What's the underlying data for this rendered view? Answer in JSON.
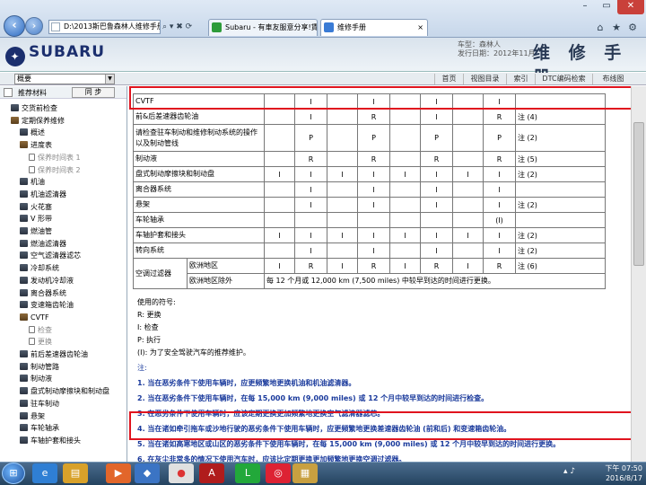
{
  "browser": {
    "address": "D:\\2013斯巴鲁森林人维修手册\\index.h",
    "tabs": [
      {
        "label": "Subaru - 有車友服意分享!賃5..."
      },
      {
        "label": "维修手册"
      }
    ],
    "back_icon": "back-arrow-icon",
    "forward_icon": "forward-arrow-icon"
  },
  "header": {
    "brand": "SUBARU",
    "model_line": "车型：森林人",
    "date_line": "发行日期：2012年11月",
    "title": "维 修 手 册"
  },
  "navbar": {
    "outline_value": "概要",
    "links": [
      "首页",
      "视图目录",
      "索引",
      "DTC编码检索",
      "布线图"
    ]
  },
  "sidebar": {
    "toolbar_title": "推荐材料",
    "sync_label": "同 步",
    "items": [
      {
        "label": "交货前检查",
        "kind": "book",
        "indent": 0
      },
      {
        "label": "定期保养维修",
        "kind": "open",
        "indent": 0
      },
      {
        "label": "概述",
        "kind": "book",
        "indent": 1
      },
      {
        "label": "进度表",
        "kind": "open",
        "indent": 1
      },
      {
        "label": "保养时间表 1",
        "kind": "page",
        "indent": 2
      },
      {
        "label": "保养时间表 2",
        "kind": "page",
        "indent": 2
      },
      {
        "label": "机油",
        "kind": "book",
        "indent": 1
      },
      {
        "label": "机油滤清器",
        "kind": "book",
        "indent": 1
      },
      {
        "label": "火花塞",
        "kind": "book",
        "indent": 1
      },
      {
        "label": "V 形带",
        "kind": "book",
        "indent": 1
      },
      {
        "label": "燃油管",
        "kind": "book",
        "indent": 1
      },
      {
        "label": "燃油滤清器",
        "kind": "book",
        "indent": 1
      },
      {
        "label": "空气滤清器滤芯",
        "kind": "book",
        "indent": 1
      },
      {
        "label": "冷却系统",
        "kind": "book",
        "indent": 1
      },
      {
        "label": "发动机冷却液",
        "kind": "book",
        "indent": 1
      },
      {
        "label": "离合器系统",
        "kind": "book",
        "indent": 1
      },
      {
        "label": "变速箱齿轮油",
        "kind": "book",
        "indent": 1
      },
      {
        "label": "CVTF",
        "kind": "open",
        "indent": 1
      },
      {
        "label": "检查",
        "kind": "page",
        "indent": 2
      },
      {
        "label": "更换",
        "kind": "page",
        "indent": 2
      },
      {
        "label": "前后差速器齿轮油",
        "kind": "book",
        "indent": 1
      },
      {
        "label": "制动管路",
        "kind": "book",
        "indent": 1
      },
      {
        "label": "制动液",
        "kind": "book",
        "indent": 1
      },
      {
        "label": "盘式制动摩擦块和制动盘",
        "kind": "book",
        "indent": 1
      },
      {
        "label": "驻车制动",
        "kind": "book",
        "indent": 1
      },
      {
        "label": "悬架",
        "kind": "book",
        "indent": 1
      },
      {
        "label": "车轮轴承",
        "kind": "book",
        "indent": 1
      },
      {
        "label": "车轴护套和接头",
        "kind": "book",
        "indent": 1
      }
    ]
  },
  "schedule": {
    "rows": [
      {
        "label": "CVTF",
        "cells": [
          "",
          "I",
          "",
          "I",
          "",
          "I",
          "",
          "I"
        ],
        "note": ""
      },
      {
        "label": "前&后差速器齿轮油",
        "cells": [
          "",
          "I",
          "",
          "R",
          "",
          "I",
          "",
          "R"
        ],
        "note": "注 (4)"
      },
      {
        "label": "请检查驻车制动和维修制动系统的操作以及制动管线",
        "cells": [
          "",
          "P",
          "",
          "P",
          "",
          "P",
          "",
          "P"
        ],
        "note": "注 (2)"
      },
      {
        "label": "制动液",
        "cells": [
          "",
          "R",
          "",
          "R",
          "",
          "R",
          "",
          "R"
        ],
        "note": "注 (5)"
      },
      {
        "label": "盘式制动摩擦块和制动盘",
        "cells": [
          "I",
          "I",
          "I",
          "I",
          "I",
          "I",
          "I",
          "I"
        ],
        "note": "注 (2)"
      },
      {
        "label": "离合器系统",
        "cells": [
          "",
          "I",
          "",
          "I",
          "",
          "I",
          "",
          "I"
        ],
        "note": ""
      },
      {
        "label": "悬架",
        "cells": [
          "",
          "I",
          "",
          "I",
          "",
          "I",
          "",
          "I"
        ],
        "note": "注 (2)"
      },
      {
        "label": "车轮轴承",
        "cells": [
          "",
          "",
          "",
          "",
          "",
          "",
          "",
          "(I)"
        ],
        "note": ""
      },
      {
        "label": "车轴护套和接头",
        "cells": [
          "I",
          "I",
          "I",
          "I",
          "I",
          "I",
          "I",
          "I"
        ],
        "note": "注 (2)"
      },
      {
        "label": "转向系统",
        "cells": [
          "",
          "I",
          "",
          "I",
          "",
          "I",
          "",
          "I"
        ],
        "note": "注 (2)"
      }
    ],
    "filter_label": "空调过滤器",
    "filter_sub1": "欧洲地区",
    "filter_sub1_cells": [
      "I",
      "R",
      "I",
      "R",
      "I",
      "R",
      "I",
      "R"
    ],
    "filter_sub1_note": "注 (6)",
    "filter_sub2": "欧洲地区除外",
    "filter_sub2_text": "每 12 个月或 12,000 km (7,500 miles) 中较早到达的时间进行更换。"
  },
  "legend": {
    "title": "使用的符号:",
    "items": [
      "R: 更换",
      "I: 检查",
      "P: 执行",
      "(I): 为了安全驾驶汽车的推荐维护。"
    ]
  },
  "notes": {
    "title": "注:",
    "items": [
      "1. 当在恶劣条件下使用车辆时，应更频繁地更换机油和机油滤清器。",
      "2. 当在恶劣条件下使用车辆时，在每 15,000 km (9,000 miles) 或 12 个月中较早到达的时间进行检查。",
      "3. 在恶劣条件下使用车辆时，应该定期更换更加频繁地更换空气滤清器滤芯。",
      "4. 当在诸如牵引拖车或沙地行驶的恶劣条件下使用车辆时，应更频繁地更换差速器齿轮油 (前和后) 和变速箱齿轮油。",
      "5. 当在诸如高寒地区或山区的恶劣条件下使用车辆时，在每 15,000 km (9,000 miles) 或 12 个月中较早到达的时间进行更换。",
      "6. 在灰尘非常多的情况下使用汽车时，应该比定期更换更加频繁地更换空调过滤器。"
    ]
  },
  "taskbar": {
    "time": "下午 07:50",
    "date": "2016/8/17"
  },
  "colors": {
    "highlight": "#e0141e",
    "notes_text": "#1a3a9c",
    "brand": "#1b2f6e"
  }
}
